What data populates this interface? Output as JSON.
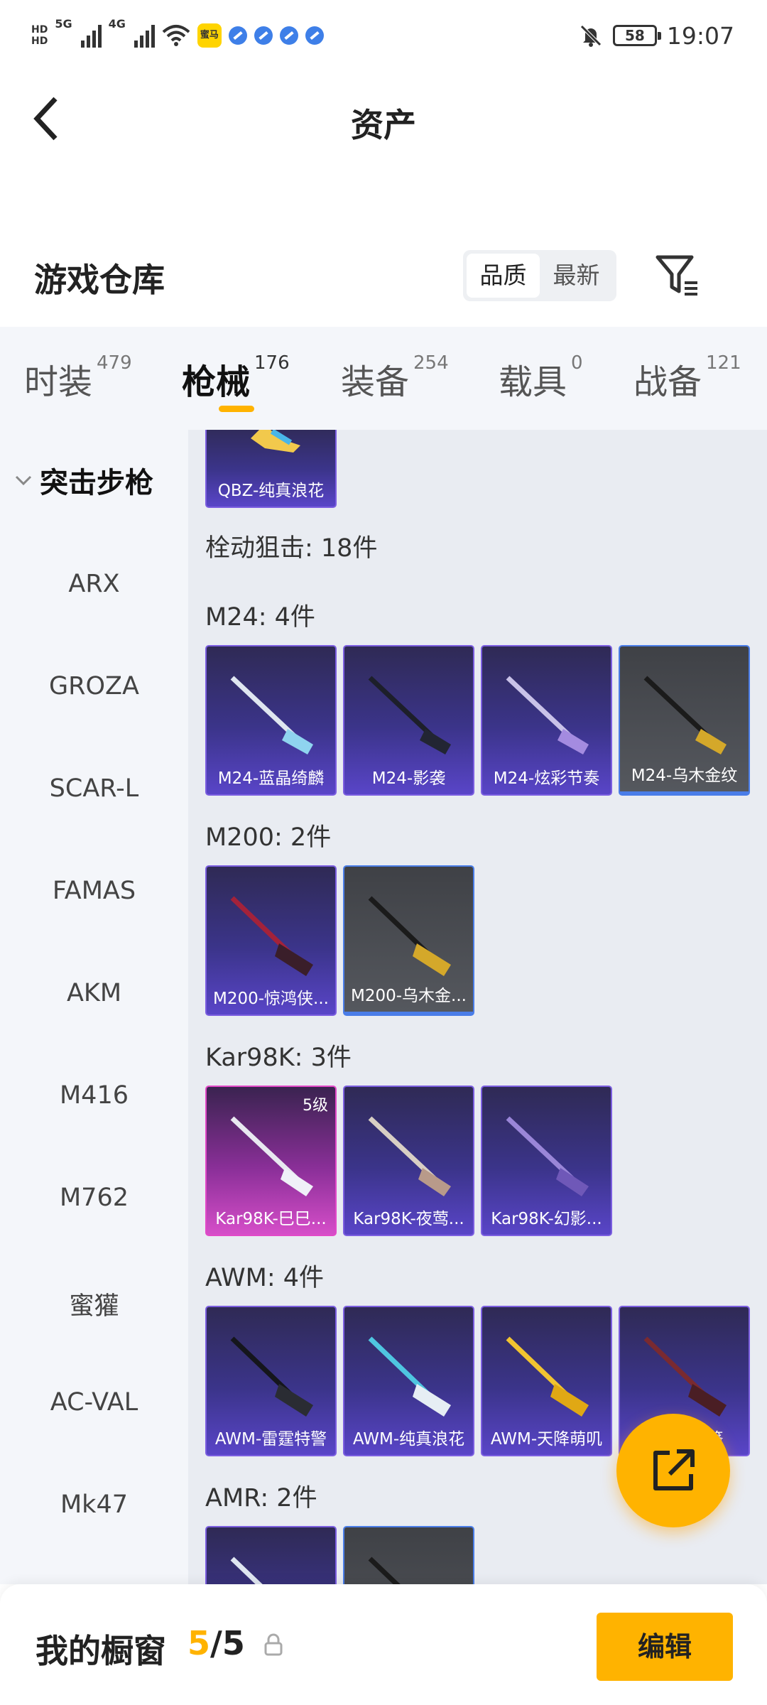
{
  "status_bar": {
    "hd_top": "HD",
    "hd_bottom": "HD",
    "net_1": "5G",
    "net_2": "4G",
    "app_badge": "蜜马",
    "battery": "58",
    "time": "19:07",
    "icons": [
      "signal-icon",
      "wifi-icon",
      "bell-off-icon",
      "battery-icon"
    ]
  },
  "header": {
    "title": "资产",
    "back_icon": "chevron-left-icon"
  },
  "warehouse": {
    "title": "游戏仓库",
    "sort_options": [
      "品质",
      "最新"
    ],
    "active_sort": "品质",
    "filter_icon": "filter-icon"
  },
  "tabs": [
    {
      "label": "时装",
      "count": "479"
    },
    {
      "label": "枪械",
      "count": "176"
    },
    {
      "label": "装备",
      "count": "254"
    },
    {
      "label": "载具",
      "count": "0"
    },
    {
      "label": "战备",
      "count": "121"
    }
  ],
  "active_tab": "枪械",
  "sidebar": {
    "category": "突击步枪",
    "items": [
      "ARX",
      "GROZA",
      "SCAR-L",
      "FAMAS",
      "AKM",
      "M416",
      "M762",
      "蜜獾",
      "AC-VAL",
      "Mk47"
    ]
  },
  "content": {
    "top_card": "QBZ-纯真浪花",
    "group_title": "栓动狙击: 18件",
    "sections": [
      {
        "title": "M24: 4件",
        "items": [
          "M24-蓝晶绮麟",
          "M24-影袭",
          "M24-炫彩节奏",
          "M24-乌木金纹"
        ]
      },
      {
        "title": "M200: 2件",
        "items": [
          "M200-惊鸿侠...",
          "M200-乌木金..."
        ]
      },
      {
        "title": "Kar98K: 3件",
        "items": [
          "Kar98K-巳巳...",
          "Kar98K-夜莺...",
          "Kar98K-幻影..."
        ],
        "level": "5级"
      },
      {
        "title": "AWM: 4件",
        "items": [
          "AWM-雷霆特警",
          "AWM-纯真浪花",
          "AWM-天降萌叽",
          "AWM-...篷"
        ]
      },
      {
        "title": "AMR: 2件",
        "items": []
      }
    ]
  },
  "fab": {
    "icon": "share-external-icon"
  },
  "bottom": {
    "label": "我的橱窗",
    "current": "5",
    "separator": "/",
    "total": "5",
    "lock_icon": "lock-icon",
    "edit_label": "编辑"
  },
  "colors": {
    "accent": "#ffb300",
    "card_purple": "#5945c8",
    "card_pink": "#d64ec9",
    "card_gray": "#55585e",
    "panel_bg": "#f4f6fa"
  }
}
